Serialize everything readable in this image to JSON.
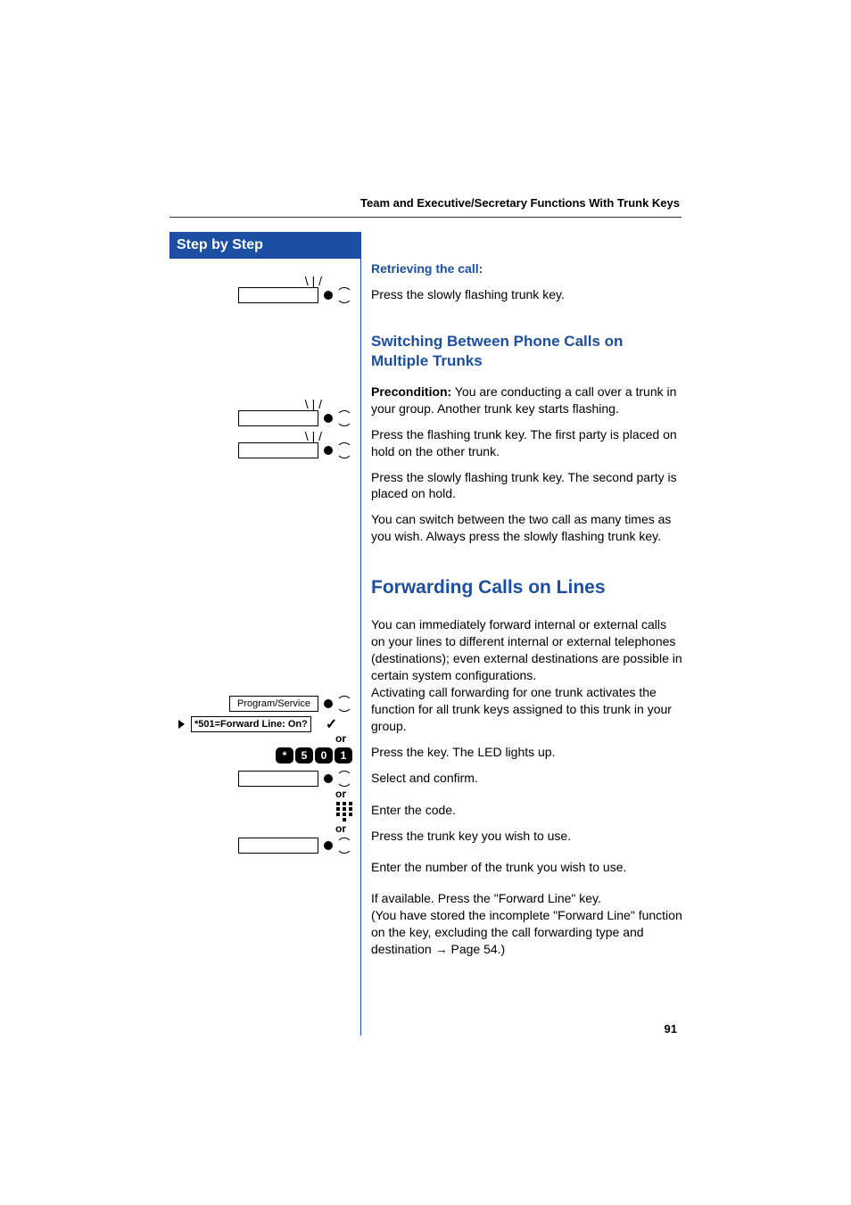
{
  "header": {
    "section_title": "Team and Executive/Secretary Functions With Trunk Keys"
  },
  "sidebar": {
    "heading": "Step by Step"
  },
  "figures": {
    "program_service_label": "Program/Service",
    "forward_line_label": "*501=Forward Line: On?",
    "or_label": "or",
    "code_keys": [
      "*",
      "5",
      "0",
      "1"
    ]
  },
  "body": {
    "retrieving_heading": "Retrieving the call:",
    "retrieving_text": "Press the slowly flashing trunk key.",
    "switching_heading": "Switching Between Phone Calls on Multiple Trunks",
    "precondition_label": "Precondition:",
    "precondition_text": " You are conducting a call over a trunk in your group. Another trunk key starts flashing.",
    "press_flashing": "Press the flashing trunk key. The first party is placed on hold on the other trunk.",
    "press_slow": "Press the slowly flashing trunk key. The second party is placed on hold.",
    "switch_info": "You can switch between the two call as many times as you wish. Always press the slowly flashing trunk key.",
    "forwarding_heading": "Forwarding Calls on Lines",
    "forwarding_intro": "You can immediately forward internal or external calls on your lines to different internal or external telephones (destinations); even external destinations are possible in certain system configurations.",
    "forwarding_activating": "Activating call forwarding for one trunk activates the function for all trunk keys assigned to this trunk in your group.",
    "press_key_led": "Press the key. The LED lights up.",
    "select_confirm": "Select and confirm.",
    "enter_code": "Enter the code.",
    "press_trunk_use": "Press the trunk key you wish to use.",
    "enter_trunk_num": "Enter the number of the trunk you wish to use.",
    "if_available": "If available. Press the \"Forward Line\" key.",
    "stored_note_1": "(You have stored the incomplete \"Forward Line\" function on the key, excluding the call forwarding type and destination ",
    "page_ref": "→ Page 54.)"
  },
  "page_number": "91"
}
